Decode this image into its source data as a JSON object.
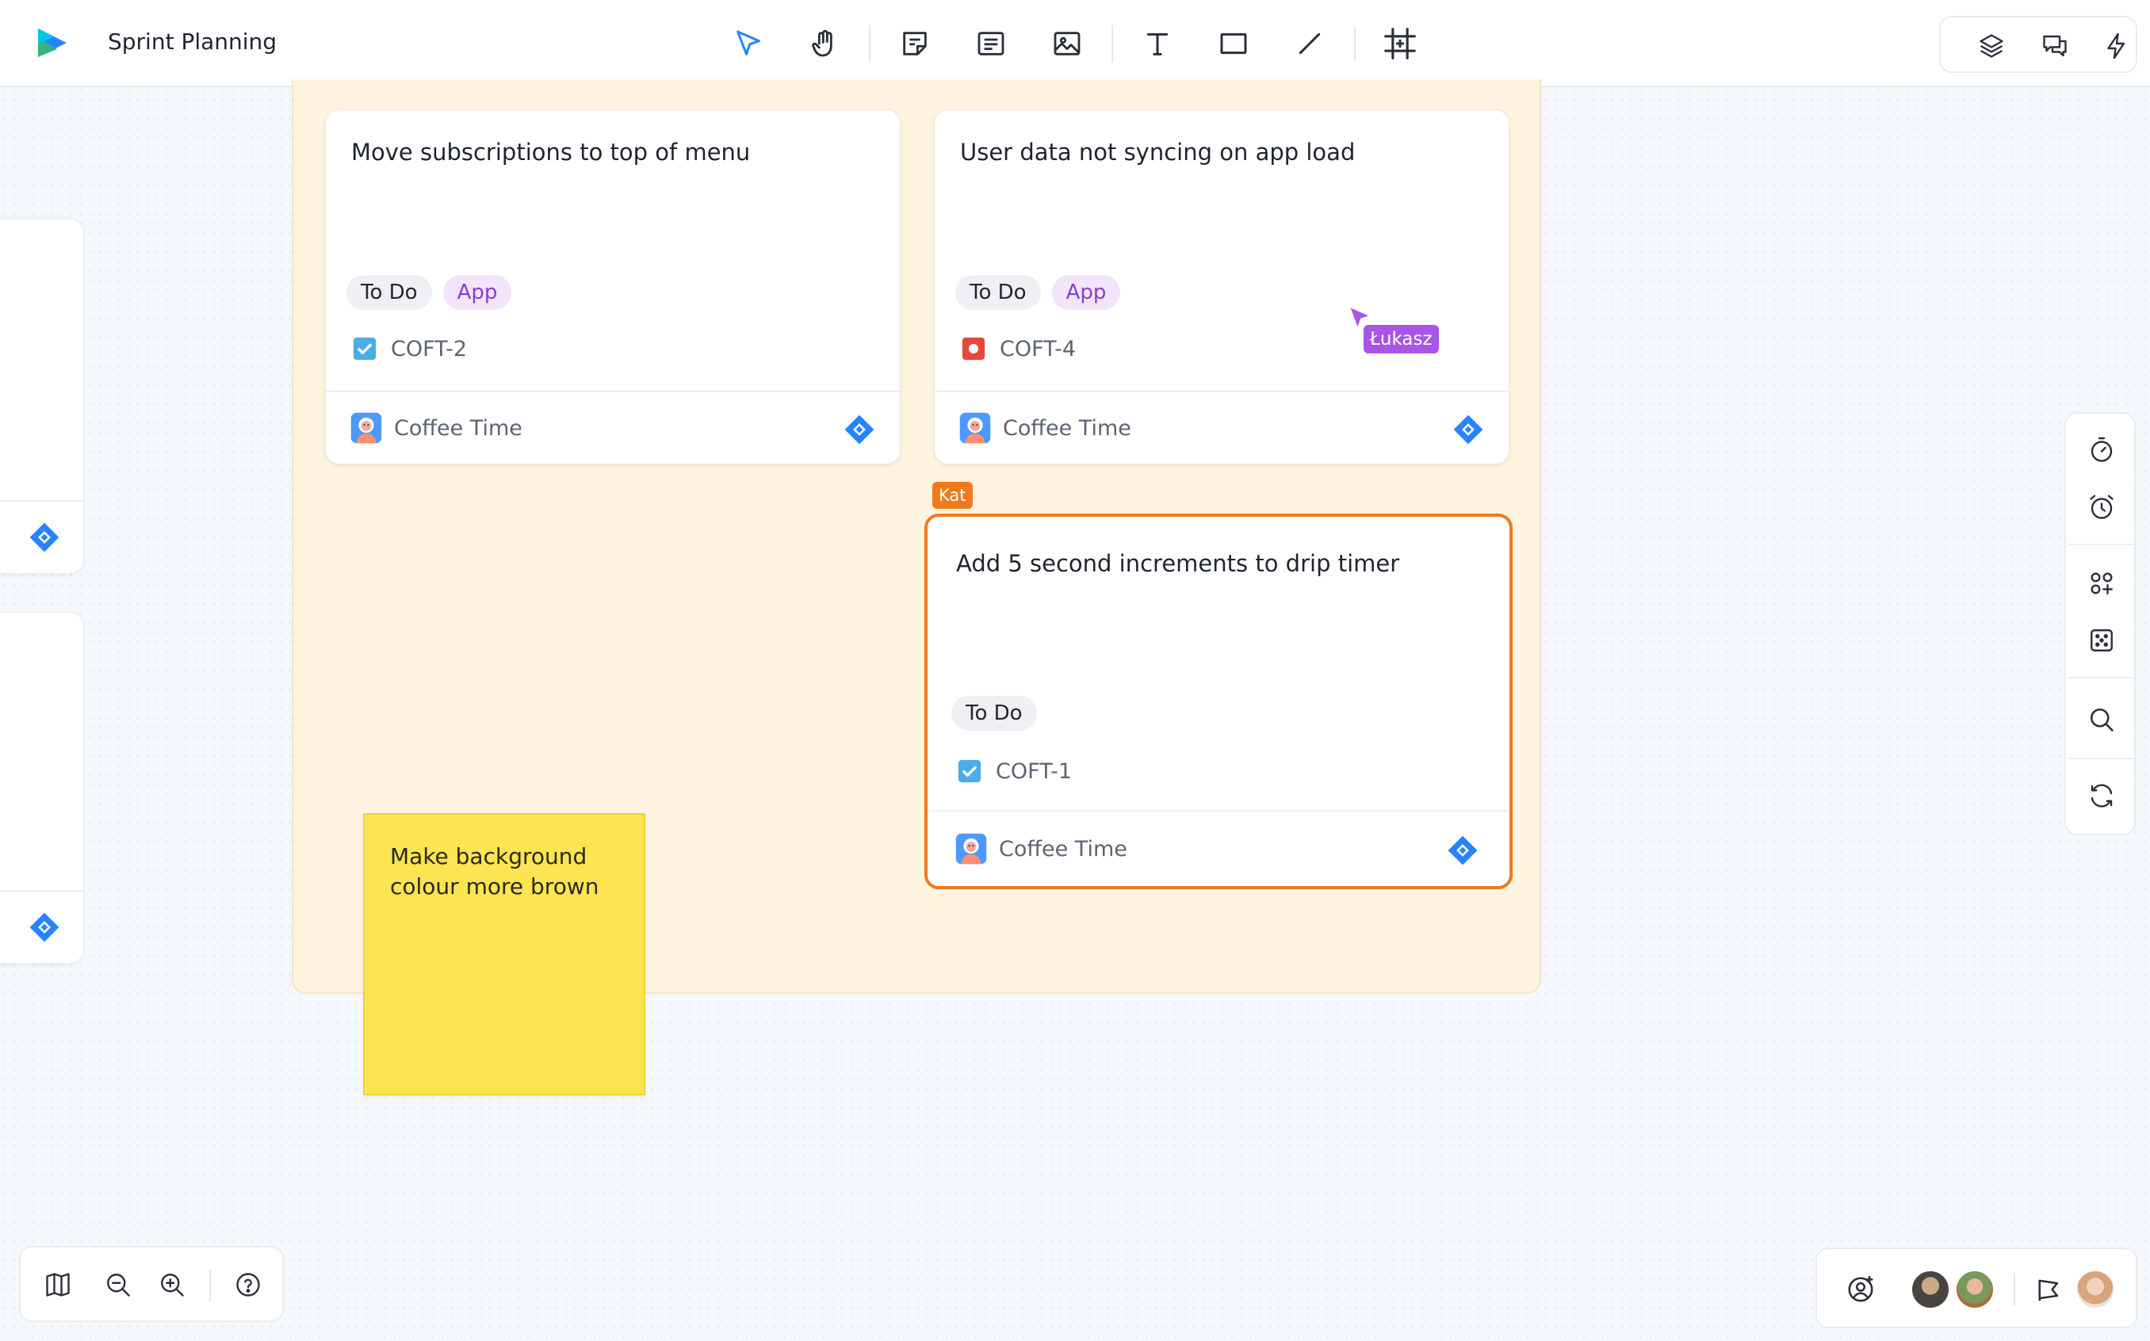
{
  "header": {
    "title": "Sprint Planning",
    "tools": [
      "select-tool",
      "hand-tool",
      "sticky-note-tool",
      "card-tool",
      "image-tool",
      "text-tool",
      "rectangle-tool",
      "line-tool",
      "frame-tool"
    ],
    "actions": [
      "layers-icon",
      "comments-icon",
      "lightning-icon"
    ]
  },
  "cards": [
    {
      "title": "Move subscriptions to top of menu",
      "tags": [
        "To Do",
        "App"
      ],
      "issue_type": "task",
      "issue_key": "COFT-2",
      "project": "Coffee Time"
    },
    {
      "title": "User data not syncing on app load",
      "tags": [
        "To Do",
        "App"
      ],
      "issue_type": "bug",
      "issue_key": "COFT-4",
      "project": "Coffee Time"
    },
    {
      "title": "Add 5 second increments to drip timer",
      "tags": [
        "To Do"
      ],
      "issue_type": "task",
      "issue_key": "COFT-1",
      "project": "Coffee Time",
      "selected": true
    }
  ],
  "cursors": [
    {
      "name": "Łukasz",
      "color": "#a855e8"
    },
    {
      "name": "Kat",
      "color": "#ee7a1e"
    }
  ],
  "sticky": {
    "text": "Make background colour more brown",
    "color": "#fde451"
  },
  "side_panel": [
    "timer-icon",
    "alarm-icon",
    "apps-icon",
    "dice-icon",
    "search-icon",
    "sync-icon"
  ],
  "zoom_bar": [
    "map-icon",
    "zoom-out-icon",
    "zoom-in-icon",
    "help-icon"
  ],
  "collab_bar": [
    "add-user-icon",
    "avatar",
    "avatar",
    "presentation-icon",
    "avatar"
  ],
  "colors": {
    "accent": "#2684ff",
    "frame": "#fff4e0",
    "selection": "#ee7a1e"
  }
}
